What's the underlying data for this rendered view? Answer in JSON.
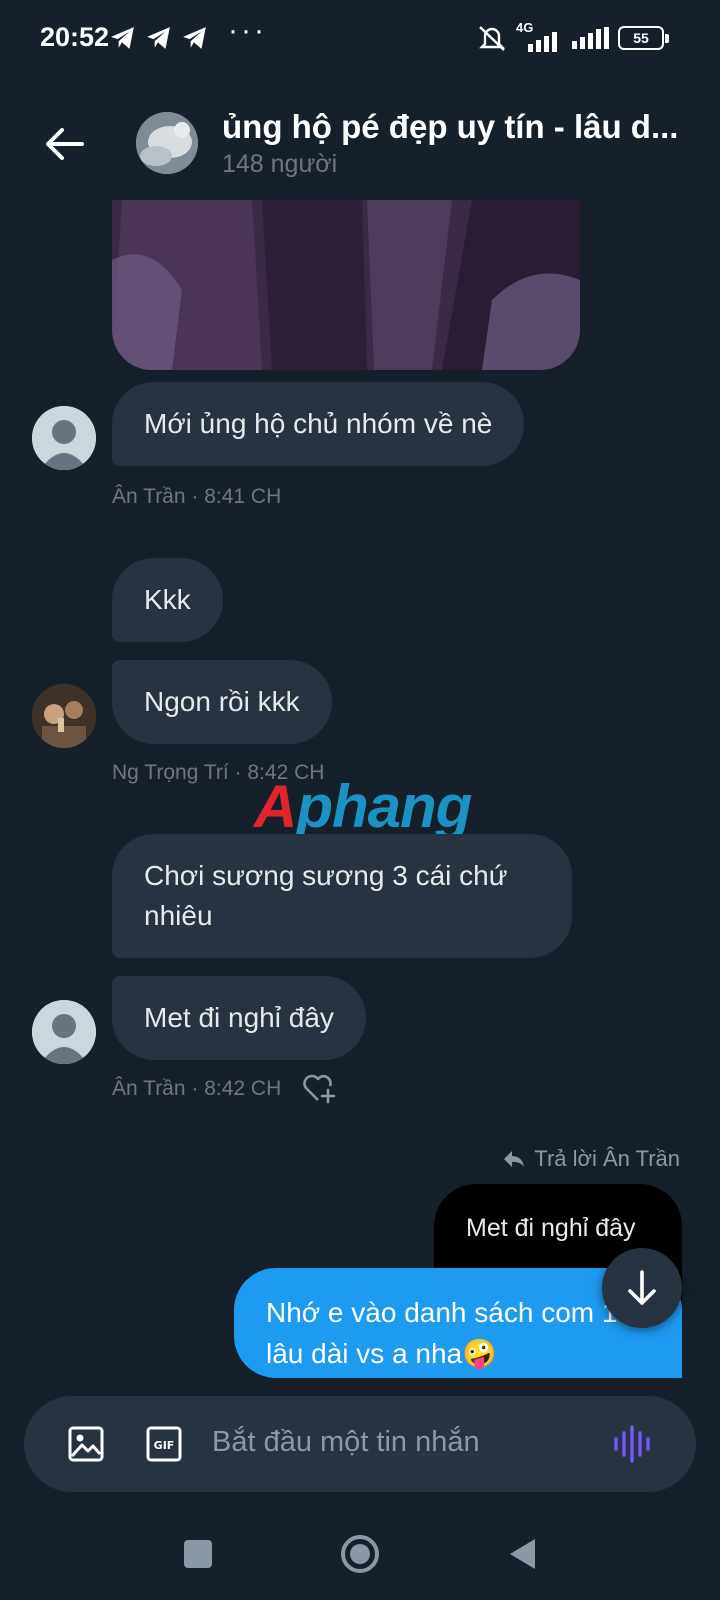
{
  "status_bar": {
    "time": "20:52",
    "dots": "···",
    "network": "4G",
    "battery": "55"
  },
  "header": {
    "title": "ủng hộ pé đẹp uy tín - lâu d...",
    "subtitle": "148 người"
  },
  "messages": [
    {
      "text": "Mới ủng hộ chủ nhóm về nè",
      "meta": "Ân Trần · 8:41 CH"
    },
    {
      "text": "Kkk"
    },
    {
      "text": "Ngon rồi kkk",
      "meta": "Ng Trọng Trí · 8:42 CH"
    },
    {
      "text": "Chơi sương sương 3 cái chứ nhiêu"
    },
    {
      "text": "Met đi nghỉ đây",
      "meta": "Ân Trần · 8:42 CH"
    }
  ],
  "reply": {
    "label": "Trả lời Ân Trần",
    "quoted_text": "Met đi nghỉ đây",
    "my_text": "Nhớ e vào danh sách com 1 lâu dài vs a nha🤪"
  },
  "watermark": {
    "part1": "A",
    "part2": "phang"
  },
  "composer": {
    "placeholder": "Bắt đầu một tin nhắn"
  },
  "colors": {
    "background": "#15202b",
    "bubble": "#273340",
    "accent": "#1d9bf0",
    "voice": "#7856ff"
  },
  "icons": [
    "back-arrow-icon",
    "image-icon",
    "gif-icon",
    "voice-icon",
    "heart-plus-icon",
    "reply-icon",
    "arrow-down-icon",
    "square-nav-icon",
    "circle-nav-icon",
    "triangle-nav-icon"
  ]
}
